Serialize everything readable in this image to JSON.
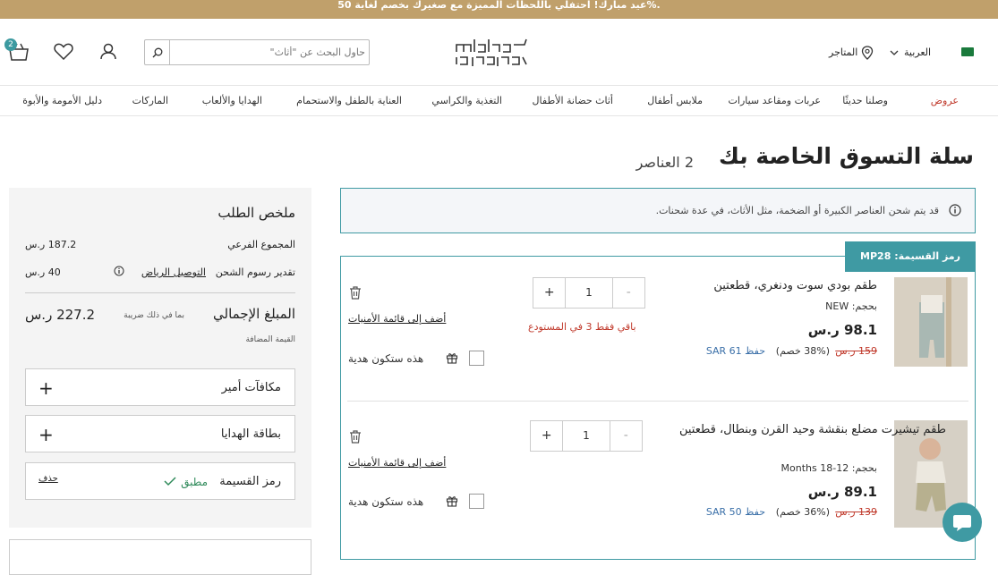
{
  "promo": {
    "text": "عيد مبارك! احتفلي باللحظات المميزة مع صغيرك بخصم لغاية 50%."
  },
  "header": {
    "language": "العربية",
    "stores": "المتاجر",
    "search_placeholder": "حاول البحث عن \"أثاث\"",
    "cart_count": "2",
    "logo_top": "ماماز",
    "logo_bottom": "باباز"
  },
  "nav": {
    "items": [
      "عروض",
      "وصلنا حديثًا",
      "عربات ومقاعد سيارات",
      "ملابس أطفال",
      "أثاث حضانة الأطفال",
      "التغذية والكراسي",
      "العناية بالطفل والاستحمام",
      "الهدايا والألعاب",
      "الماركات",
      "دليل الأمومة والأبوة"
    ]
  },
  "cart": {
    "title": "سلة التسوق الخاصة بك",
    "count": "2 العناصر",
    "notice": "قد يتم شحن العناصر الكبيرة أو الضخمة، مثل الأثاث، في عدة شحنات.",
    "promo_tag": "رمز القسيمة: MP28",
    "items": [
      {
        "name": "طقم بودي سوت ودنغري، قطعتين",
        "size": "بحجم: NEW",
        "price": "98.1 ر.س",
        "old_price": "159 ر.س",
        "discount": "(38% خصم)",
        "saving": "حفظ SAR 61",
        "qty": "1",
        "stock": "باقي فقط 3 في المستودع",
        "wishlist": "أضف إلى قائمة الأمنيات",
        "gift": "هذه ستكون هدية"
      },
      {
        "name": "طقم تيشيرت مضلع بنقشة وحيد القرن وبنطال، قطعتين",
        "size": "بحجم: 12-18 Months",
        "price": "89.1 ر.س",
        "old_price": "139 ر.س",
        "discount": "(36% خصم)",
        "saving": "حفظ SAR 50",
        "qty": "1",
        "stock": "",
        "wishlist": "أضف إلى قائمة الأمنيات",
        "gift": "هذه ستكون هدية"
      }
    ]
  },
  "summary": {
    "title": "ملخص الطلب",
    "subtotal_label": "المجموع الفرعي",
    "subtotal": "187.2 ر.س",
    "shipping_label": "تقدير رسوم الشحن",
    "shipping_city": "التوصيل الرياض",
    "shipping": "40 ر.س",
    "total_label": "المبلغ الإجمالي",
    "total_note": "بما في ذلك ضريبة",
    "total_note2": "القيمة المضافة",
    "total": "227.2 ر.س",
    "rewards": "مكافآت أمير",
    "giftcard": "بطاقة الهدايا",
    "coupon": "رمز القسيمة",
    "coupon_status": "مطبق",
    "coupon_remove": "حذف"
  },
  "colors": {
    "accent": "#3f9aa3",
    "promo": "#c0a06b",
    "sale": "#c0392b"
  }
}
